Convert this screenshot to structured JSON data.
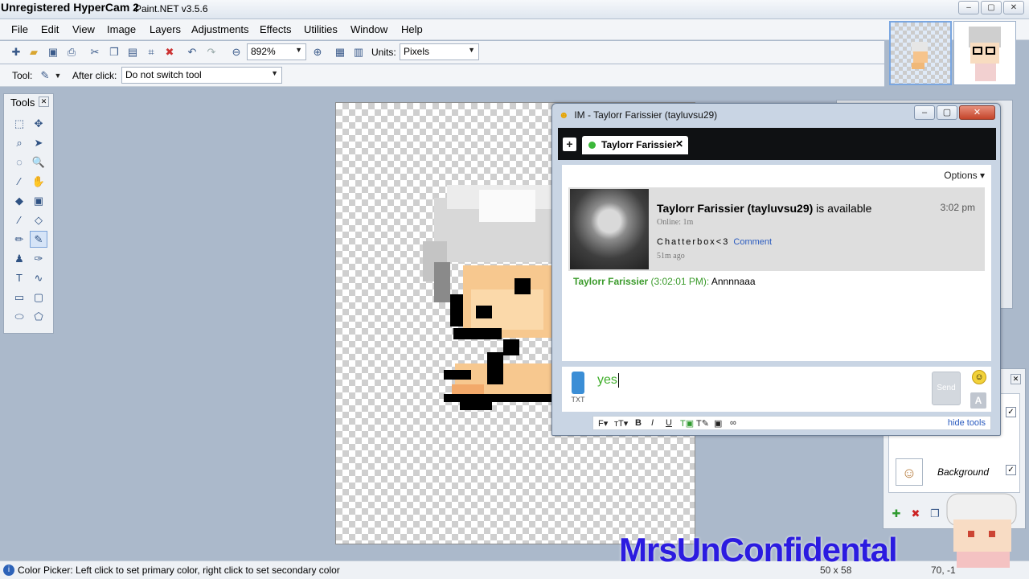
{
  "titlebar": {
    "watermark": "Unregistered HyperCam 2",
    "app_title": "Paint.NET v3.5.6",
    "min": "–",
    "max": "▢",
    "close": "✕"
  },
  "menu": [
    "File",
    "Edit",
    "View",
    "Image",
    "Layers",
    "Adjustments",
    "Effects",
    "Utilities",
    "Window",
    "Help"
  ],
  "toolbar": {
    "zoom": "892%",
    "units_label": "Units:",
    "units_value": "Pixels"
  },
  "toolbar2": {
    "tool_label": "Tool:",
    "after_click_label": "After click:",
    "after_click_value": "Do not switch tool"
  },
  "tools": {
    "title": "Tools",
    "close": "✕"
  },
  "layers": {
    "background_name": "Background",
    "check": "✓"
  },
  "im": {
    "title": "IM - Taylorr Farissier (tayluvsu29)",
    "tab_name": "Taylorr Farissier",
    "tab_close": "✕",
    "options": "Options ▾",
    "contact_name": "Taylorr Farissier (tayluvsu29)",
    "availability": " is available",
    "card_time": "3:02 pm",
    "online": "Online: 1m",
    "status_text": "Chatterbox<3",
    "comment_link": "Comment",
    "status_ago": "51m ago",
    "msg_sender": "Taylorr Farissier",
    "msg_time": " (3:02:01 PM): ",
    "msg_text": "Annnnaaa",
    "input_text": "yes",
    "send": "Send",
    "phone_label": "TXT",
    "font_a": "A",
    "hide_tools": "hide tools"
  },
  "statusbar": {
    "text": "Color Picker: Left click to set primary color, right click to set secondary color",
    "image_size": "50 x 58",
    "coords": "70, -1"
  },
  "watermark_text": "MrsUnConfidental"
}
